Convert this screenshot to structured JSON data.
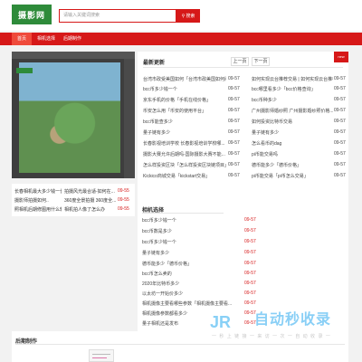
{
  "header": {
    "logo_text": "摄影网",
    "search_placeholder": "请输入关键词搜索",
    "search_button_label": "搜索"
  },
  "nav": {
    "items": [
      {
        "label": "首页"
      },
      {
        "label": "相机选择"
      },
      {
        "label": "后期制作"
      }
    ]
  },
  "hero": {
    "image_name": "photo-edit-screenshot"
  },
  "left_list": {
    "row1_left": "长春相机最大多少钱一长...",
    "row1_right": "拍摄风光最合适-如何在...",
    "row1_time": "09-55",
    "row2_left": "摄影师拍摄如何..",
    "row2_right": "360度全景拍摄 360度全...",
    "row2_time": "09-55",
    "row3_left": "照相机后期修图用什么软...",
    "row3_right": "相机拍人像了怎么办",
    "row3_time": "09-55"
  },
  "news": {
    "title": "最新更新",
    "prev": "上一页",
    "next": "下一页",
    "badge": "new",
    "items": [
      {
        "text": "台湾市政受美国如何「台湾市政美国如何问题...",
        "time": "09-57"
      },
      {
        "text": "如何实现云台推荐交易 | 如何实现云台推荐...",
        "time": "09-57"
      },
      {
        "text": "bcc币多少钱一个",
        "time": "09-57"
      },
      {
        "text": "bcc哪里看多少「bcc价格查询」",
        "time": "09-57"
      },
      {
        "text": "京东手机的价格「手机在线价格」",
        "time": "09-57"
      },
      {
        "text": "bcc币种多少",
        "time": "09-57"
      },
      {
        "text": "币安怎么用「币安的使用平台」",
        "time": "09-57"
      },
      {
        "text": "广州摄影师婚纱照 广州摄影婚纱照价格...",
        "time": "09-57"
      },
      {
        "text": "bcc币能查多少",
        "time": "09-57"
      },
      {
        "text": "如何投资比特币交易",
        "time": "09-57"
      },
      {
        "text": "量子链有多少",
        "time": "09-57"
      },
      {
        "text": "量子链有多少",
        "time": "09-57"
      },
      {
        "text": "长春影视培训学校 长春影视培训学校哪...",
        "time": "09-57"
      },
      {
        "text": "怎么看币的dag",
        "time": "09-57"
      },
      {
        "text": "摄影大赛允许后期吗-国际摄影大赛不能...",
        "time": "09-57"
      },
      {
        "text": "pi币能交易吗",
        "time": "09-57"
      },
      {
        "text": "怎么样投资区块「怎么样投资区块链项目」",
        "time": "09-57"
      },
      {
        "text": "德币能多少「德币价格」",
        "time": "09-57"
      },
      {
        "text": "Kickico商城交易「kickstart交易」",
        "time": "09-57"
      },
      {
        "text": "pi币能交易「pi币怎么交易」",
        "time": "09-57"
      }
    ]
  },
  "camera": {
    "title": "相机选择",
    "items": [
      {
        "text": "bcc币多少钱一个",
        "time": "09-57"
      },
      {
        "text": "bcc币数是多少",
        "time": "09-57"
      },
      {
        "text": "bcc币多少钱一个",
        "time": "09-57"
      },
      {
        "text": "量子链有多少",
        "time": "09-57"
      },
      {
        "text": "德币能多少「德币价格」",
        "time": "09-57"
      },
      {
        "text": "bcc币怎么卖的",
        "time": "09-57"
      },
      {
        "text": "2020年比特币多少",
        "time": "09-57"
      },
      {
        "text": "以太坊一开始价多少",
        "time": "09-57"
      },
      {
        "text": "相机摄像主要看哪些参数「相机摄像主要看...",
        "time": "09-57"
      },
      {
        "text": "相机摄像参数都看多少",
        "time": "09-57"
      },
      {
        "text": "量子相机还是发布",
        "time": "09-57"
      },
      {
        "text": "比特币最低交易多少",
        "time": "09-57"
      },
      {
        "text": "比特币是什么交易「比特币发布的交易」",
        "time": "09-57"
      },
      {
        "text": "量子链有多少「中国区块链币种有多少」",
        "time": "09-57"
      }
    ]
  },
  "post": {
    "title": "后期制作"
  },
  "watermark": {
    "logo": "JR",
    "name": "自动秒收录",
    "sub": "一 秒 上 链 接 一 来 访 一 次 一 自 动 收 录 一"
  }
}
